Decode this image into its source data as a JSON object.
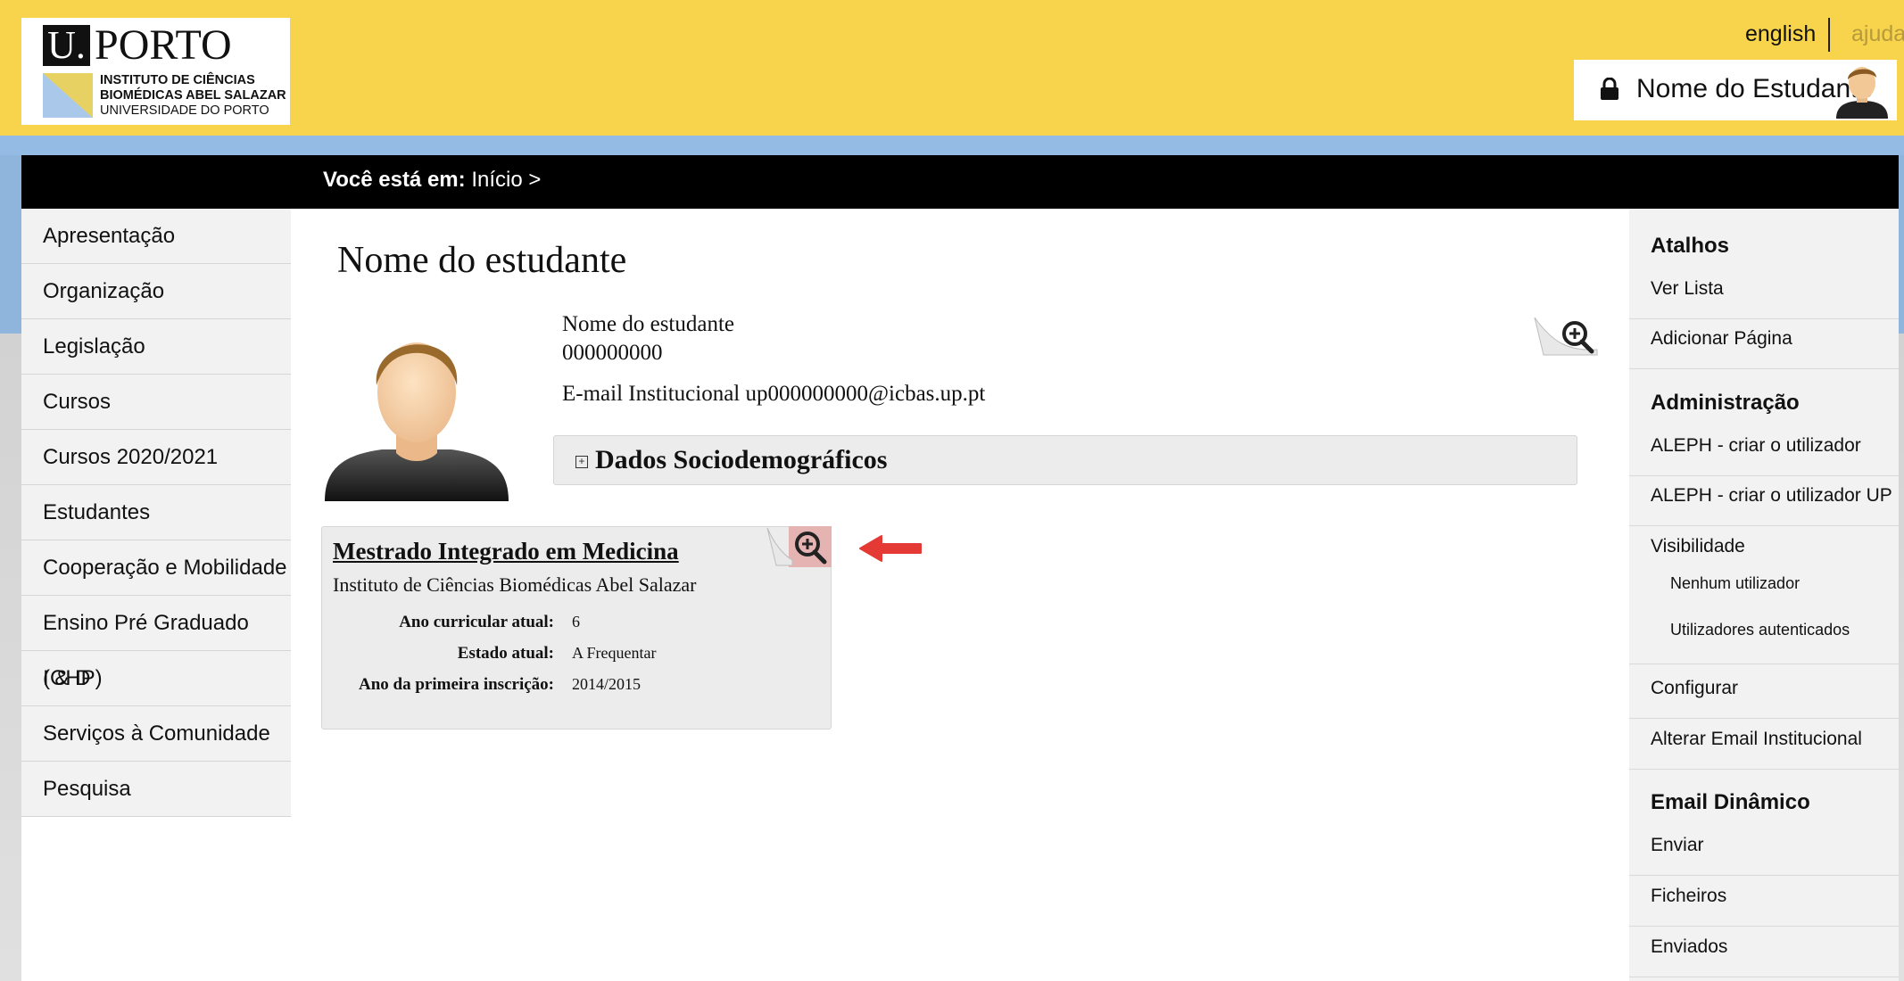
{
  "header": {
    "logo": {
      "u": "U.",
      "porto": "PORTO",
      "line1": "INSTITUTO DE CIÊNCIAS",
      "line2": "BIOMÉDICAS ABEL SALAZAR",
      "line3": "UNIVERSIDADE DO PORTO"
    },
    "lang_link": "english",
    "help_link": "ajuda",
    "user_name": "Nome do Estudante"
  },
  "breadcrumb": {
    "prefix": "Você está em:",
    "path": "Início >"
  },
  "left_menu": [
    {
      "label": "Apresentação"
    },
    {
      "label": "Organização"
    },
    {
      "label": "Legislação"
    },
    {
      "label": "Cursos"
    },
    {
      "label": "Cursos 2020/2021"
    },
    {
      "label": "Estudantes"
    },
    {
      "label": "Cooperação e Mobilidade"
    },
    {
      "label": "Ensino Pré Graduado (CHP)"
    },
    {
      "label": "I & D"
    },
    {
      "label": "Serviços à Comunidade"
    },
    {
      "label": "Pesquisa"
    }
  ],
  "main": {
    "page_title": "Nome do estudante",
    "student_name": "Nome do estudante",
    "student_number": "000000000",
    "email_line": "E-mail Institucional up000000000@icbas.up.pt",
    "socio_title": "Dados Sociodemográficos",
    "course": {
      "title": "Mestrado Integrado em Medicina",
      "school": "Instituto de Ciências Biomédicas Abel Salazar",
      "fields": [
        {
          "label": "Ano curricular atual:",
          "value": "6"
        },
        {
          "label": "Estado atual:",
          "value": "A Frequentar"
        },
        {
          "label": "Ano da primeira inscrição:",
          "value": "2014/2015"
        }
      ]
    }
  },
  "right_sidebar": {
    "shortcuts_title": "Atalhos",
    "shortcuts": [
      "Ver Lista",
      "Adicionar Página"
    ],
    "admin_title": "Administração",
    "admin": [
      "ALEPH - criar o utilizador",
      "ALEPH - criar o utilizador UP"
    ],
    "visibility_title": "Visibilidade",
    "visibility": [
      "Nenhum utilizador",
      "Utilizadores autenticados"
    ],
    "admin2": [
      "Configurar",
      "Alterar Email Institucional"
    ],
    "email_title": "Email Dinâmico",
    "email": [
      "Enviar",
      "Ficheiros",
      "Enviados"
    ]
  },
  "colors": {
    "header_yellow": "#f7d44c",
    "nav_black": "#000000",
    "blue_band": "#94bbe3",
    "arrow_red": "#e53935"
  }
}
